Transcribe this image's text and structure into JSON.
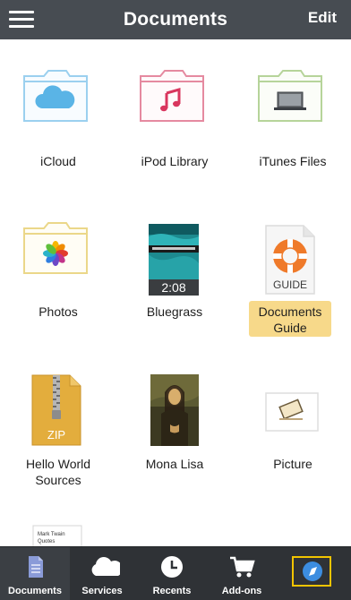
{
  "header": {
    "title": "Documents",
    "edit_label": "Edit"
  },
  "items": [
    {
      "name": "iCloud",
      "icon": "icloud-folder-icon",
      "color": "#5ab4e6"
    },
    {
      "name": "iPod Library",
      "icon": "music-folder-icon",
      "color": "#d9365e"
    },
    {
      "name": "iTunes Files",
      "icon": "itunes-folder-icon",
      "color": "#8fb56a"
    },
    {
      "name": "Photos",
      "icon": "photos-folder-icon",
      "color": "#e8d26b"
    },
    {
      "name": "Bluegrass",
      "icon": "video-thumbnail",
      "duration": "2:08"
    },
    {
      "name_line1": "Documents",
      "name_line2": "Guide",
      "icon": "guide-document-icon",
      "badge": "GUIDE",
      "highlight_color": "#f7d98a"
    },
    {
      "name_line1": "Hello World",
      "name_line2": "Sources",
      "icon": "zip-file-icon",
      "badge": "ZIP"
    },
    {
      "name": "Mona Lisa",
      "icon": "image-thumbnail"
    },
    {
      "name": "Picture",
      "icon": "picture-thumbnail"
    },
    {
      "name": "",
      "icon": "document-thumbnail",
      "snippet_line1": "Mark Twain",
      "snippet_line2": "Quotes"
    }
  ],
  "tabbar": {
    "tabs": [
      {
        "label": "Documents",
        "icon": "documents-icon",
        "active": true
      },
      {
        "label": "Services",
        "icon": "cloud-icon"
      },
      {
        "label": "Recents",
        "icon": "clock-icon"
      },
      {
        "label": "Add-ons",
        "icon": "cart-icon"
      },
      {
        "label": "",
        "icon": "compass-icon",
        "highlight_color": "#f2c400"
      }
    ]
  },
  "colors": {
    "navbar": "#474c52",
    "tabbar": "#2f3236",
    "accent": "#3c8de0"
  }
}
